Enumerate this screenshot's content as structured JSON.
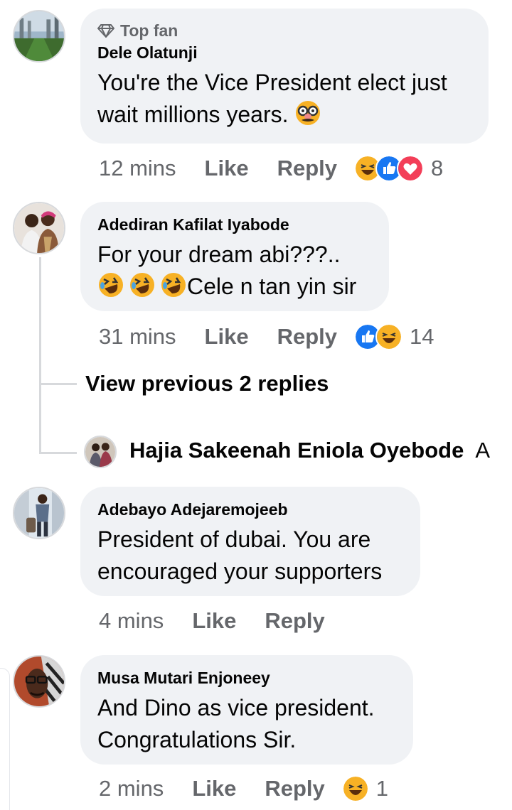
{
  "comments": [
    {
      "badge": "Top fan",
      "author": "Dele Olatunji",
      "text_line1": "You're the Vice President elect just",
      "text_line2": "wait millions years.",
      "time": "12 mins",
      "like": "Like",
      "reply": "Reply",
      "reaction_count": "8",
      "reactions": [
        "haha-icon",
        "like-icon",
        "love-icon"
      ],
      "emoji": [
        "disguise-face-emoji"
      ]
    },
    {
      "author": "Adediran Kafilat Iyabode",
      "text_line1": "For your dream abi???..",
      "text_line2": "Cele n tan yin sir",
      "time": "31 mins",
      "like": "Like",
      "reply": "Reply",
      "reaction_count": "14",
      "reactions": [
        "like-icon",
        "haha-icon"
      ],
      "emoji": [
        "rofl-emoji",
        "rofl-emoji",
        "rofl-emoji"
      ]
    },
    {
      "author": "Adebayo Adejaremojeeb",
      "text_line1": "President of dubai. You are",
      "text_line2": "encouraged your supporters",
      "time": "4 mins",
      "like": "Like",
      "reply": "Reply"
    },
    {
      "author": "Musa Mutari Enjoneey",
      "text_line1": "And Dino as vice president.",
      "text_line2": "Congratulations Sir.",
      "time": "2 mins",
      "like": "Like",
      "reply": "Reply",
      "reaction_count": "1",
      "reactions": [
        "haha-icon"
      ]
    }
  ],
  "thread": {
    "view_previous": "View previous 2 replies",
    "reply_author": "Hajia Sakeenah Eniola Oyebode",
    "reply_snippet": "A"
  },
  "colors": {
    "bubble": "#f0f2f5",
    "secondary_text": "#65676b",
    "like_blue": "#1877f2",
    "love_red": "#f33e58",
    "haha_yellow": "#f7b125"
  }
}
